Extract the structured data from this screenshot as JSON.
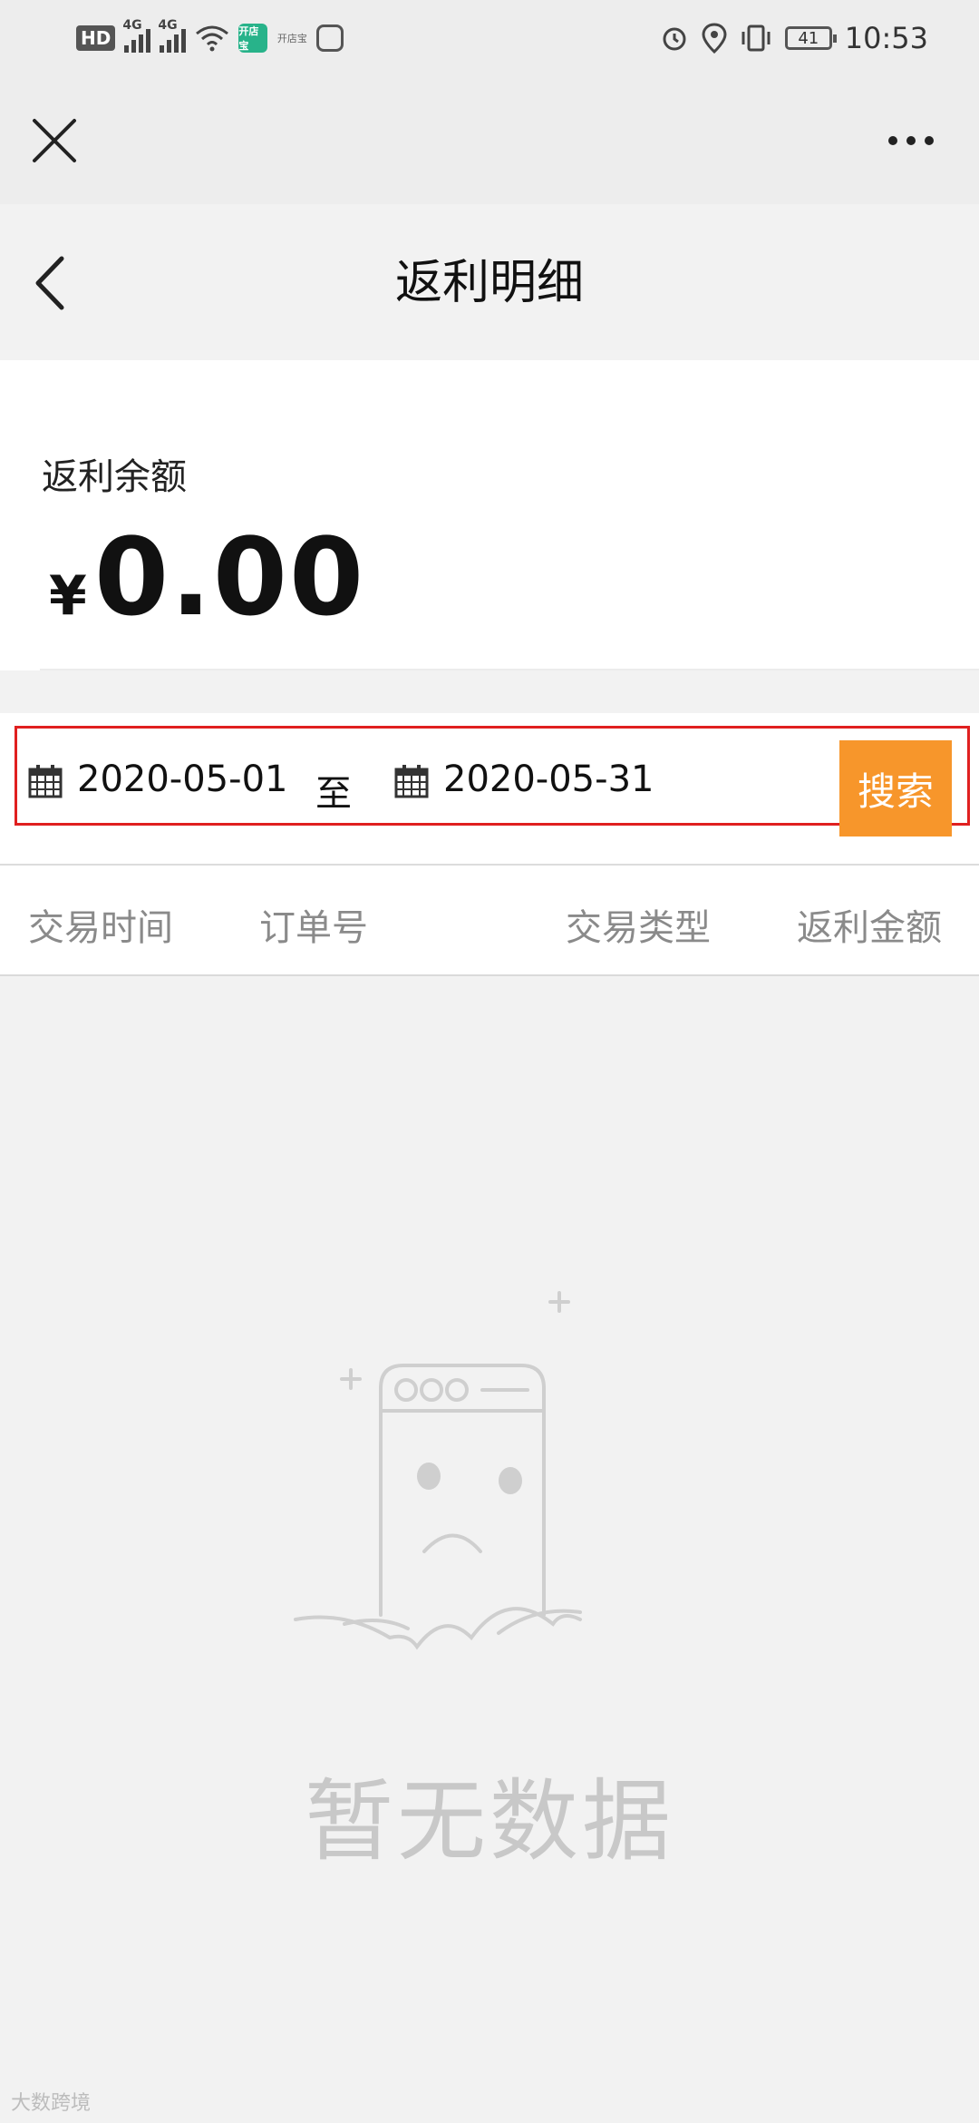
{
  "status_bar": {
    "hd_label": "HD",
    "net1": "4G",
    "net2": "4G",
    "app_badge1": "开店宝",
    "app_badge2": "开店宝",
    "battery": "41",
    "time": "10:53"
  },
  "page": {
    "title": "返利明细"
  },
  "balance": {
    "label": "返利余额",
    "currency": "¥",
    "amount": "0.00"
  },
  "filter": {
    "start_date": "2020-05-01",
    "separator": "至",
    "end_date": "2020-05-31",
    "search_label": "搜索"
  },
  "table": {
    "columns": [
      "交易时间",
      "订单号",
      "交易类型",
      "返利金额"
    ]
  },
  "empty_state": {
    "message": "暂无数据"
  },
  "watermark": "大数跨境",
  "colors": {
    "accent": "#f7962b",
    "highlight_outline": "#e02020"
  }
}
